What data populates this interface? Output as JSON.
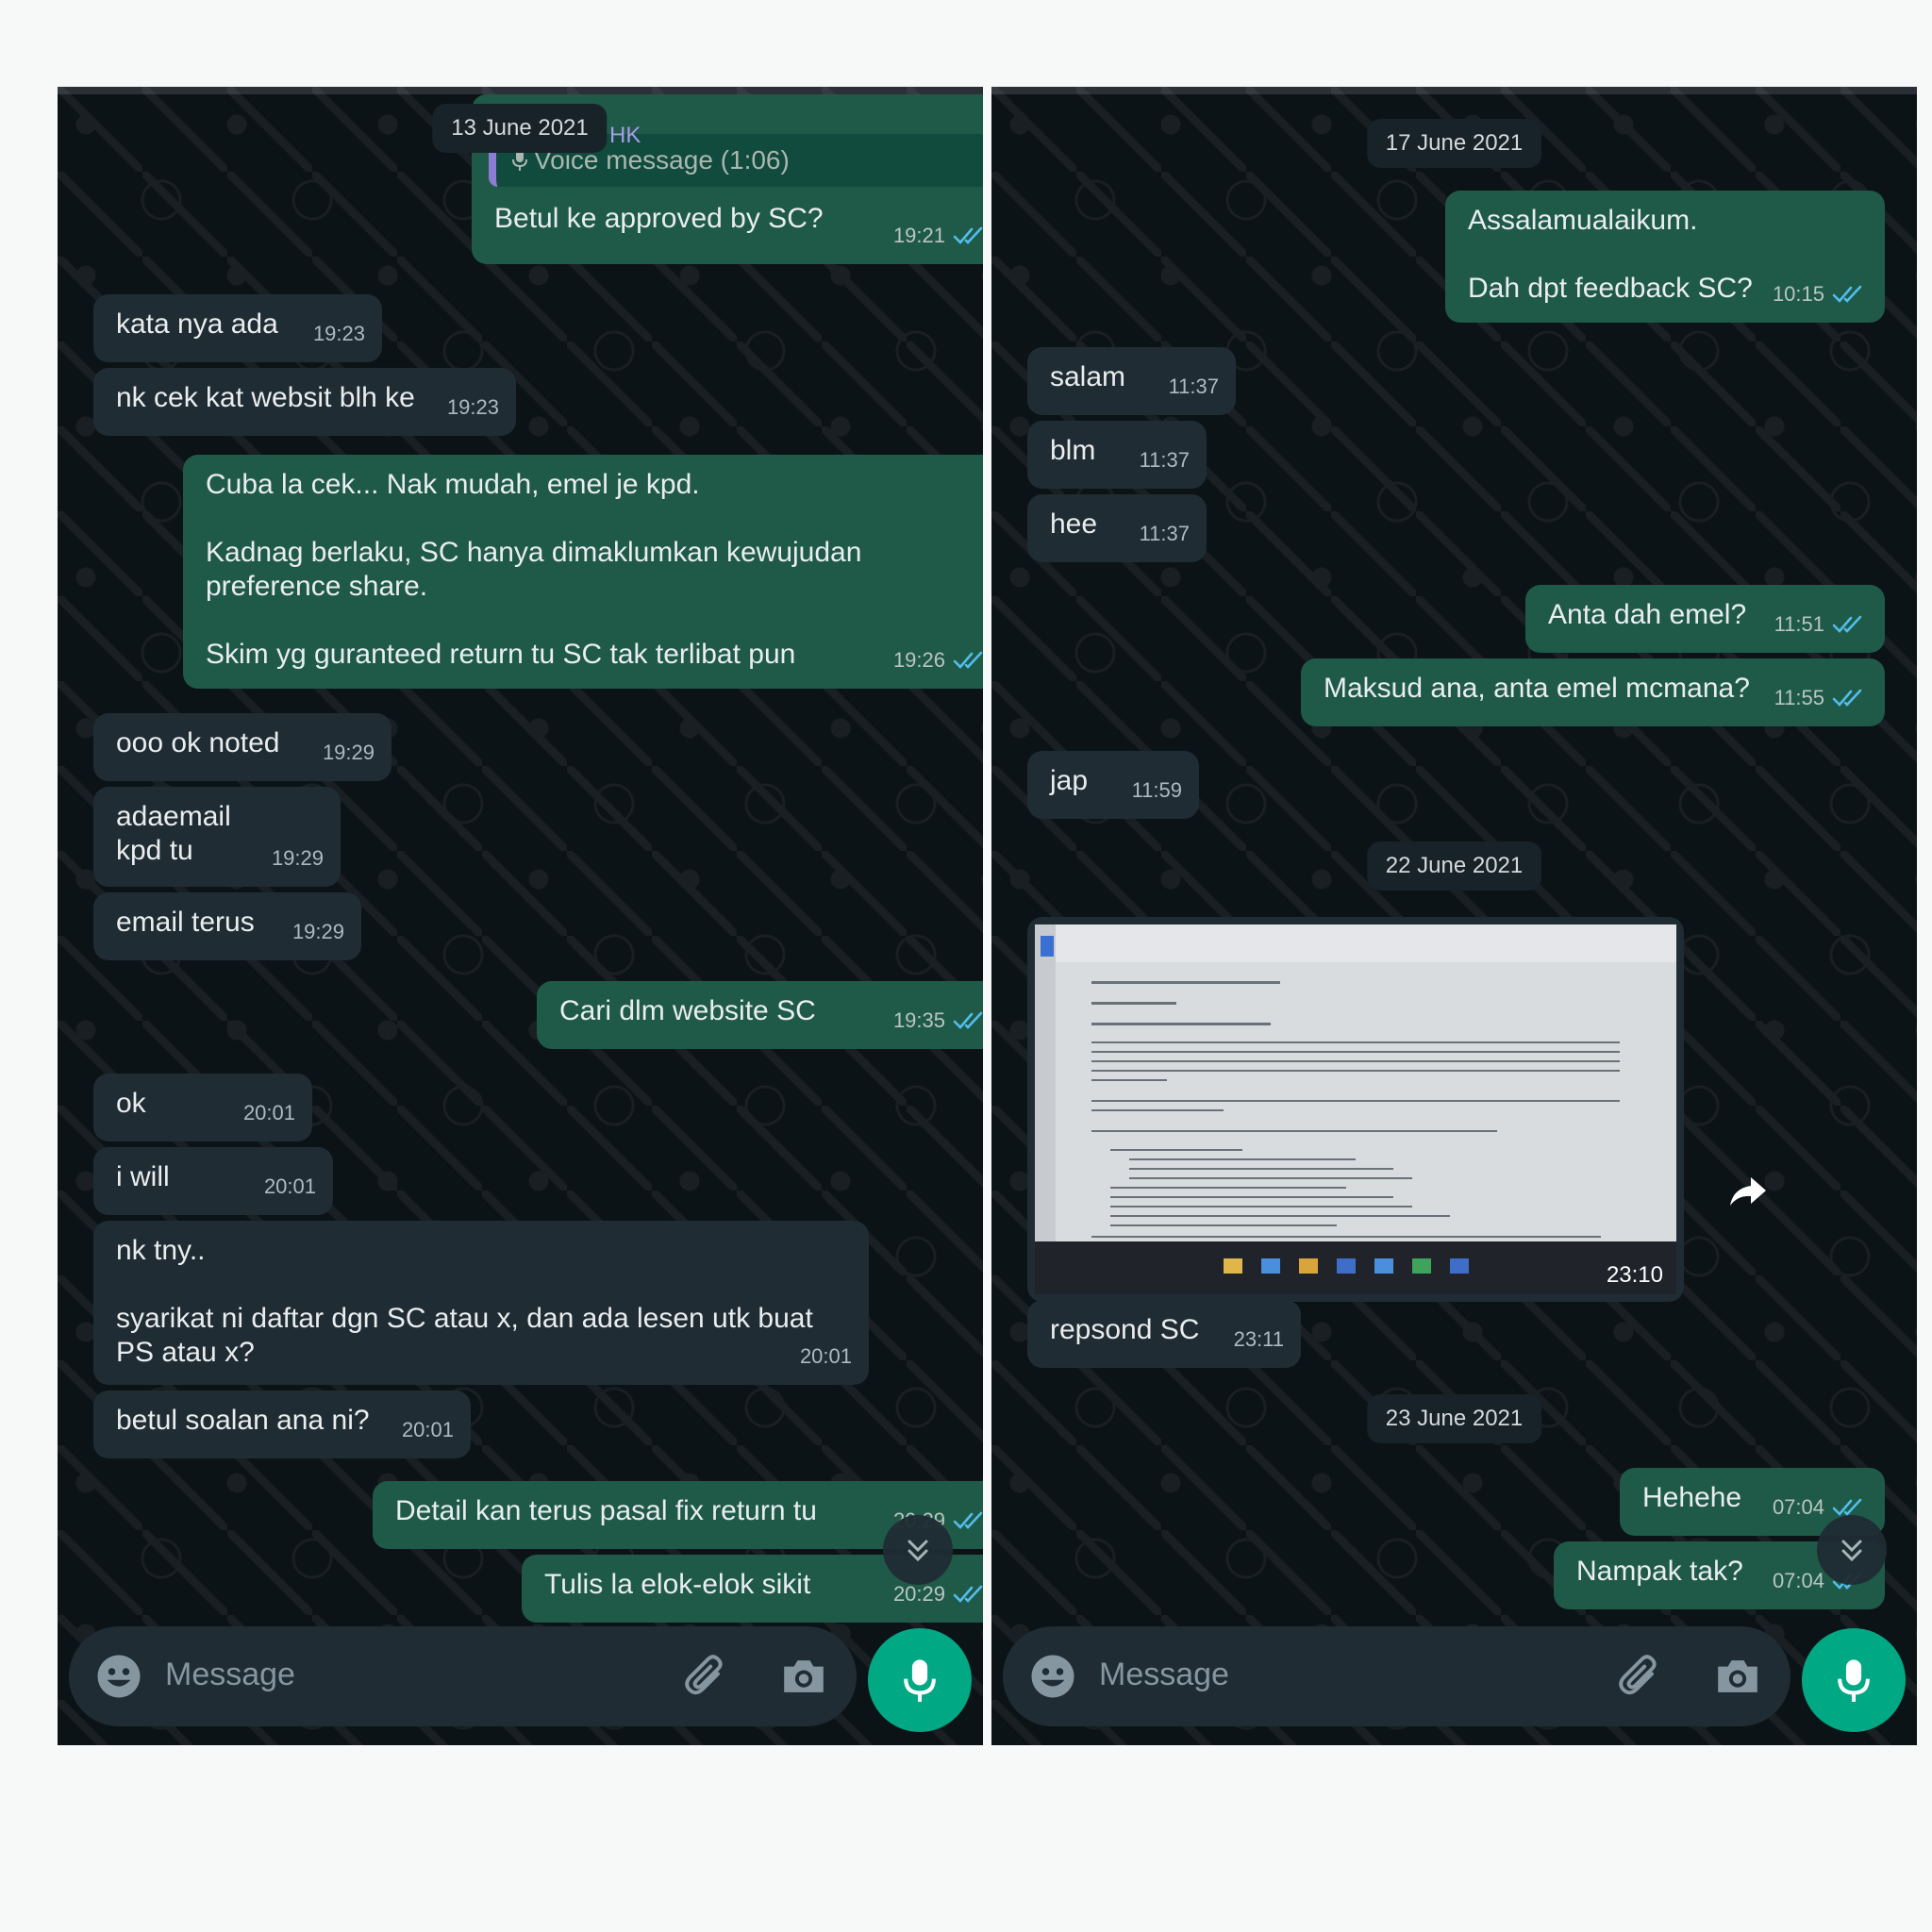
{
  "left": {
    "date_chip": "13 June 2021",
    "quoted": {
      "name": "HK",
      "text": "Voice message (1:06)"
    },
    "messages": [
      {
        "dir": "out",
        "text": "Betul ke approved by SC?",
        "time": "19:21"
      },
      {
        "dir": "in",
        "text": "kata nya ada",
        "time": "19:23"
      },
      {
        "dir": "in",
        "text": "nk cek kat websit blh ke",
        "time": "19:23"
      },
      {
        "dir": "out",
        "text": "Cuba la cek... Nak mudah, emel je kpd.\n\nKadnag berlaku, SC hanya dimaklumkan kewujudan preference share.\n\nSkim yg guranteed return tu SC tak terlibat pun",
        "time": "19:26"
      },
      {
        "dir": "in",
        "text": "ooo ok noted",
        "time": "19:29"
      },
      {
        "dir": "in",
        "text": "adaemail\nkpd tu",
        "time": "19:29"
      },
      {
        "dir": "in",
        "text": "email terus",
        "time": "19:29"
      },
      {
        "dir": "out",
        "text": "Cari dlm website SC",
        "time": "19:35"
      },
      {
        "dir": "in",
        "text": "ok",
        "time": "20:01"
      },
      {
        "dir": "in",
        "text": "i will",
        "time": "20:01"
      },
      {
        "dir": "in",
        "text": "nk tny..\n\nsyarikat ni daftar dgn SC atau x, dan ada lesen utk buat PS atau x?",
        "time": "20:01"
      },
      {
        "dir": "in",
        "text": "betul soalan ana ni?",
        "time": "20:01"
      },
      {
        "dir": "out",
        "text": "Detail kan terus pasal fix return tu",
        "time": "20:29"
      },
      {
        "dir": "out",
        "text": "Tulis la elok-elok sikit",
        "time": "20:29"
      }
    ],
    "placeholder": "Message"
  },
  "right": {
    "date_chips": [
      "17 June 2021",
      "22 June 2021",
      "23 June 2021"
    ],
    "messages": [
      {
        "dir": "out",
        "text": "Assalamualaikum.\n\nDah dpt feedback SC?",
        "time": "10:15"
      },
      {
        "dir": "in",
        "text": "salam",
        "time": "11:37"
      },
      {
        "dir": "in",
        "text": "blm",
        "time": "11:37"
      },
      {
        "dir": "in",
        "text": "hee",
        "time": "11:37"
      },
      {
        "dir": "out",
        "text": "Anta dah emel?",
        "time": "11:51"
      },
      {
        "dir": "out",
        "text": "Maksud ana, anta emel mcmana?",
        "time": "11:55"
      },
      {
        "dir": "in",
        "text": "jap",
        "time": "11:59"
      },
      {
        "dir": "in",
        "text": "repsond SC",
        "time": "23:11"
      },
      {
        "dir": "out",
        "text": "Hehehe",
        "time": "07:04"
      },
      {
        "dir": "out",
        "text": "Nampak tak?",
        "time": "07:04"
      }
    ],
    "image_message": {
      "time": "23:10"
    },
    "placeholder": "Message"
  },
  "icons": [
    "emoji-icon",
    "attach-icon",
    "camera-icon",
    "mic-icon",
    "scroll-down-icon",
    "forward-icon",
    "double-check-icon"
  ],
  "colors": {
    "background": "#0c1317",
    "incoming": "#202c33",
    "outgoing": "#1f5a48",
    "accent": "#00a884",
    "tick": "#53bdeb"
  }
}
